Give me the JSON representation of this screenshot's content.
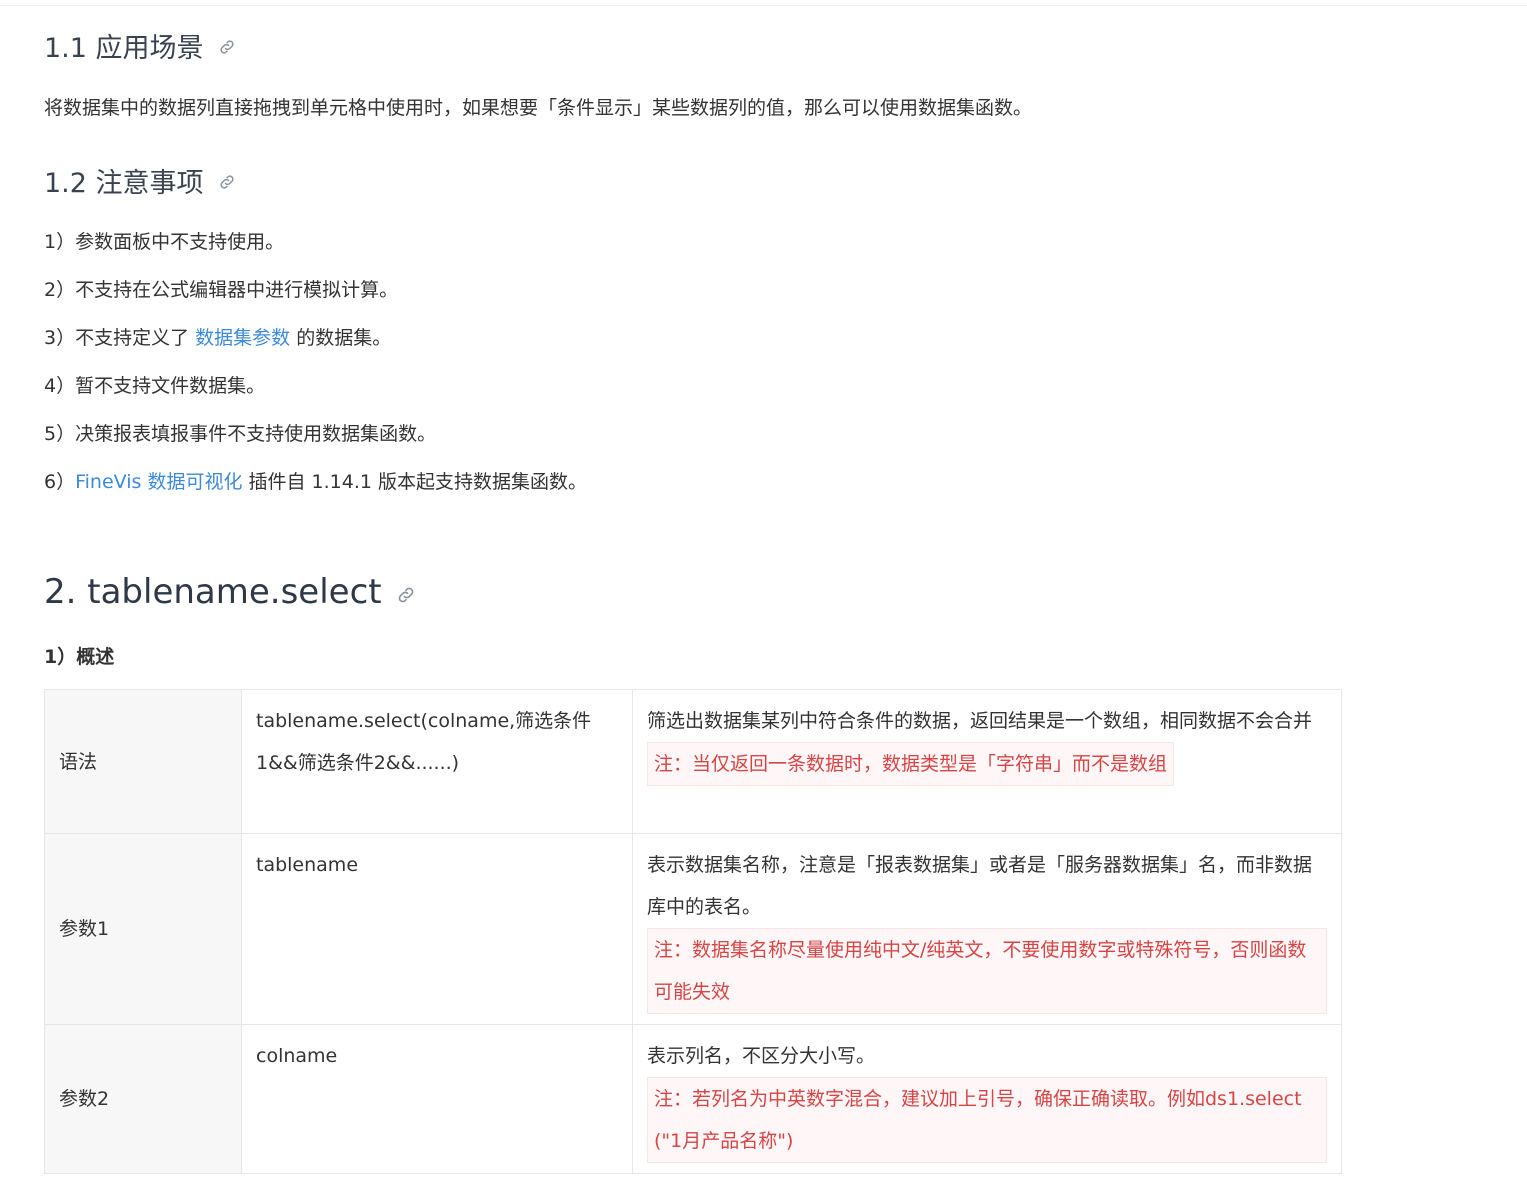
{
  "section_1_1": {
    "title": "1.1 应用场景",
    "paragraph": "将数据集中的数据列直接拖拽到单元格中使用时，如果想要「条件显示」某些数据列的值，那么可以使用数据集函数。"
  },
  "section_1_2": {
    "title": "1.2 注意事项",
    "items": [
      {
        "text": "1）参数面板中不支持使用。"
      },
      {
        "text": "2）不支持在公式编辑器中进行模拟计算。"
      },
      {
        "prefix": "3）不支持定义了 ",
        "link": "数据集参数",
        "suffix": " 的数据集。"
      },
      {
        "text": "4）暂不支持文件数据集。"
      },
      {
        "text": "5）决策报表填报事件不支持使用数据集函数。"
      },
      {
        "prefix": "6）",
        "link": "FineVis 数据可视化",
        "suffix": " 插件自 1.14.1 版本起支持数据集函数。"
      }
    ]
  },
  "section_2": {
    "title": "2. tablename.select",
    "overview_label": "1）概述",
    "rows": [
      {
        "label": "语法",
        "value": "tablename.select(colname,筛选条件1&&筛选条件2&&......)",
        "description": "筛选出数据集某列中符合条件的数据，返回结果是一个数组，相同数据不会合并",
        "note": "注：当仅返回一条数据时，数据类型是「字符串」而不是数组"
      },
      {
        "label": "参数1",
        "value": "tablename",
        "description": "表示数据集名称，注意是「报表数据集」或者是「服务器数据集」名，而非数据库中的表名。",
        "note": "注：数据集名称尽量使用纯中文/纯英文，不要使用数字或特殊符号，否则函数可能失效"
      },
      {
        "label": "参数2",
        "value": "colname",
        "description": "表示列名，不区分大小写。",
        "note": "注：若列名为中英数字混合，建议加上引号，确保正确读取。例如ds1.select(\"1月产品名称\")"
      }
    ]
  },
  "colors": {
    "link": "#3d8ad8",
    "note_text": "#d64545",
    "note_bg": "#fff7f7",
    "label_bg": "#f7f7f7"
  },
  "icons": {
    "anchor": "link-icon"
  }
}
